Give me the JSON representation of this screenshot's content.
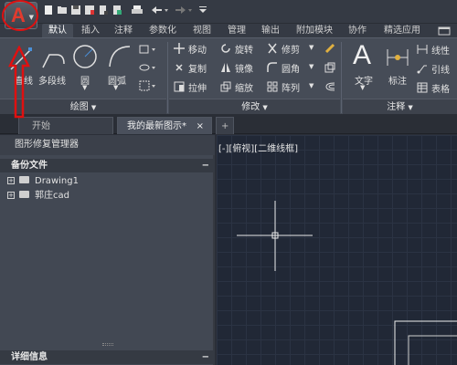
{
  "app": {
    "logo_letter": "A"
  },
  "ribbon_tabs": [
    "默认",
    "插入",
    "注释",
    "参数化",
    "视图",
    "管理",
    "输出",
    "附加模块",
    "协作",
    "精选应用"
  ],
  "draw_panel": {
    "title": "绘图",
    "buttons": {
      "line": "直线",
      "polyline": "多段线",
      "circle": "圆",
      "arc": "圆弧"
    }
  },
  "modify_panel": {
    "title": "修改",
    "buttons": {
      "move": "移动",
      "rotate": "旋转",
      "trim": "修剪",
      "copy": "复制",
      "mirror": "镜像",
      "fillet": "圆角",
      "stretch": "拉伸",
      "scale": "缩放",
      "array": "阵列"
    }
  },
  "annotation_panel": {
    "title": "注释",
    "buttons": {
      "text": "文字",
      "dimension": "标注",
      "linear": "线性",
      "leader": "引线",
      "table": "表格"
    }
  },
  "doc_tabs": {
    "start": "开始",
    "current": "我的最新图示*",
    "close": "×",
    "add": "+"
  },
  "palette": {
    "title": "图形修复管理器",
    "backup_section": "备份文件",
    "items": [
      "Drawing1",
      "郭庄cad"
    ],
    "details_section": "详细信息",
    "collapse": "−"
  },
  "viewport": {
    "label": "[-][俯视][二维线框]"
  },
  "colors": {
    "annotation": "#e01010",
    "canvas": "#212836",
    "ribbon": "#464c57"
  }
}
